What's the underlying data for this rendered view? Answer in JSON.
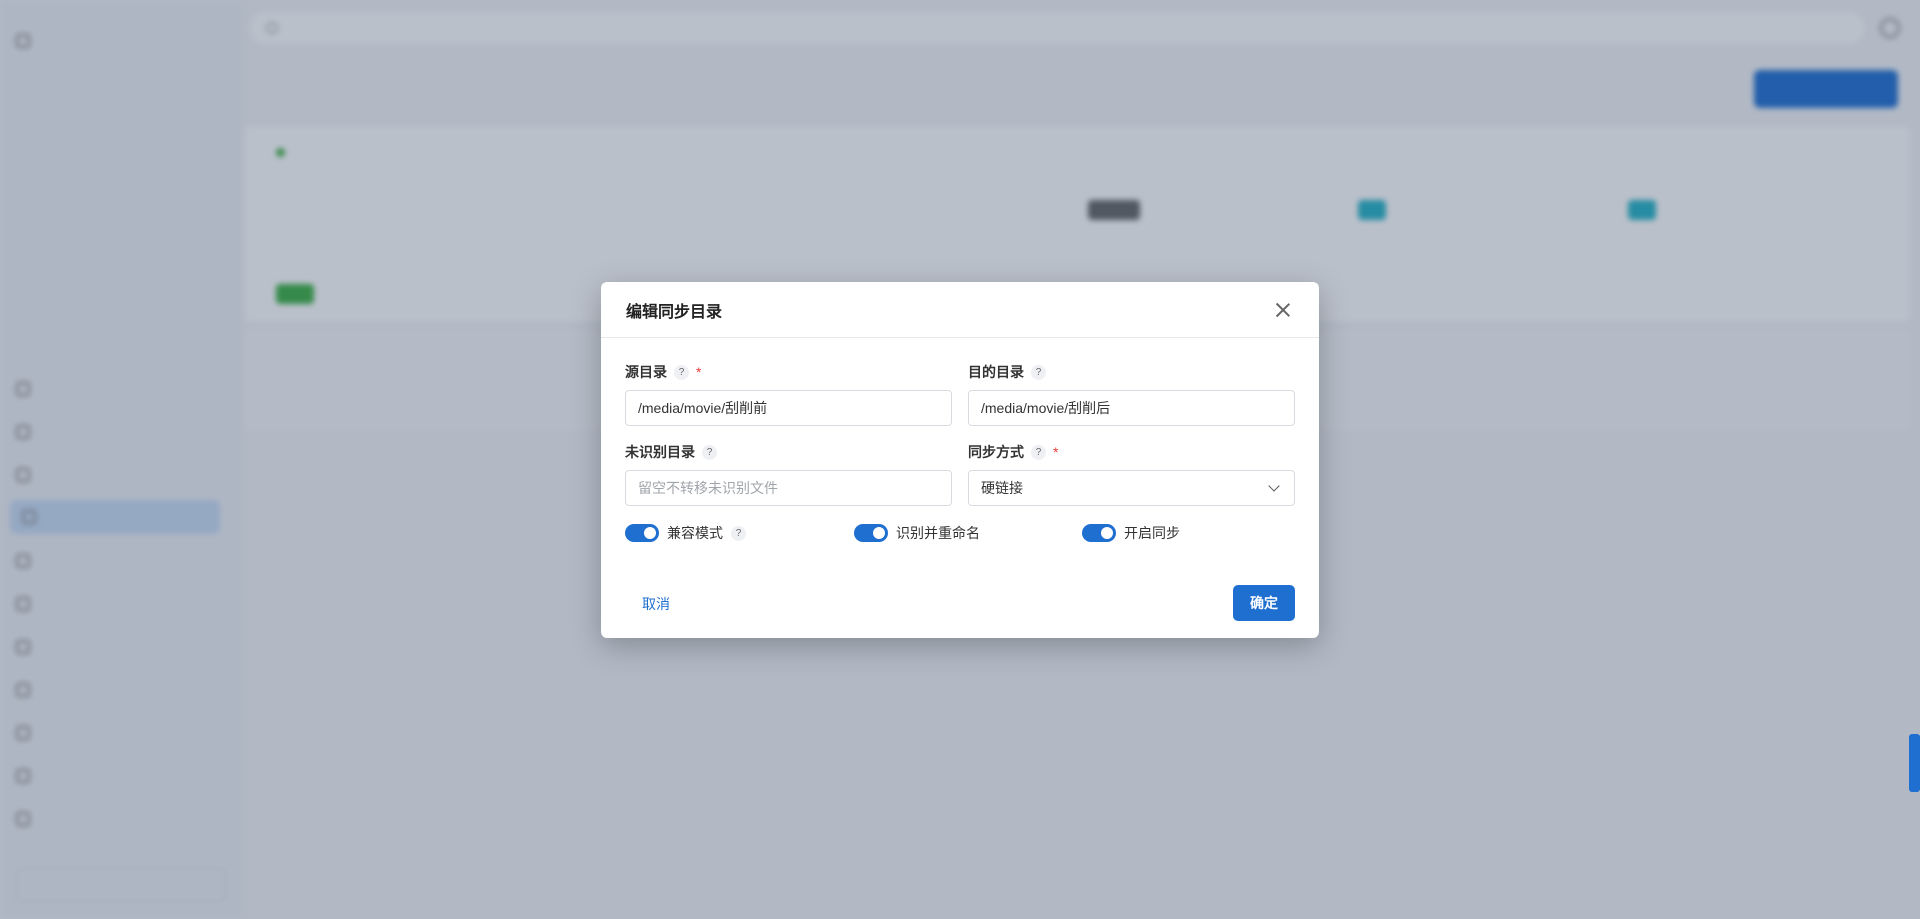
{
  "dialog": {
    "title": "编辑同步目录",
    "source": {
      "label": "源目录",
      "help": "?",
      "required": "*",
      "value": "/media/movie/刮削前"
    },
    "target": {
      "label": "目的目录",
      "help": "?",
      "value": "/media/movie/刮削后"
    },
    "unrecognized": {
      "label": "未识别目录",
      "help": "?",
      "placeholder": "留空不转移未识别文件"
    },
    "sync_mode": {
      "label": "同步方式",
      "help": "?",
      "required": "*",
      "value": "硬链接"
    },
    "switches": [
      {
        "label": "兼容模式",
        "help": "?",
        "on": true
      },
      {
        "label": "识别并重命名",
        "on": true
      },
      {
        "label": "开启同步",
        "on": true
      }
    ],
    "cancel_label": "取消",
    "confirm_label": "确定"
  },
  "colors": {
    "primary": "#1f6fd1",
    "required": "#e53935"
  }
}
